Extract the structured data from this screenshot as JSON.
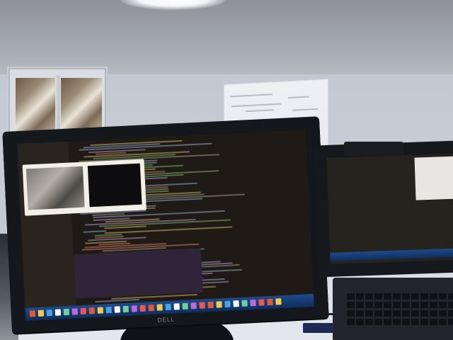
{
  "scene": {
    "description_free": true,
    "brand_text": "DELL",
    "colors": {
      "wall": "#c4c9d2",
      "monitor_bezel": "#14171c",
      "editor_bg": "#1f1a16",
      "taskbar": "#1e4a8a",
      "dialog": "#f2efe8"
    }
  }
}
